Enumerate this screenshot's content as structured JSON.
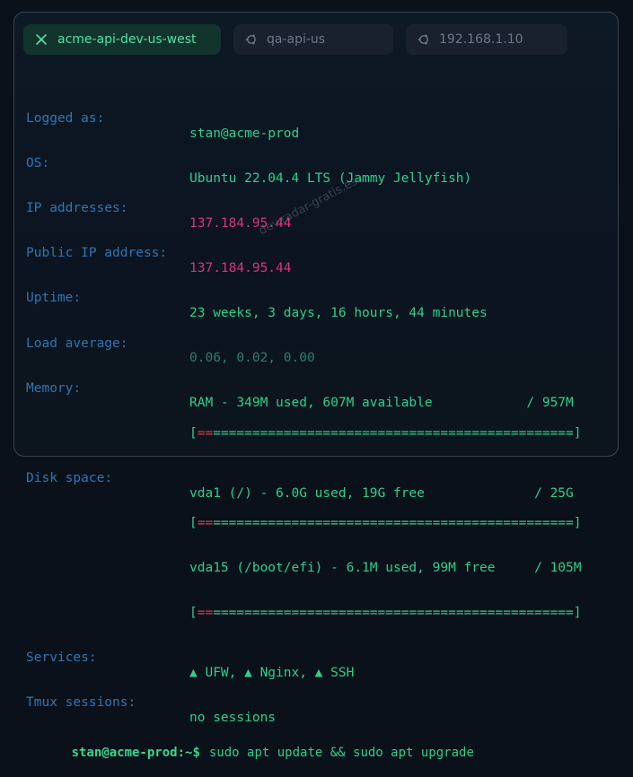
{
  "tabs": [
    {
      "label": "acme-api-dev-us-west",
      "icon": "close-icon",
      "active": true
    },
    {
      "label": "qa-api-us",
      "icon": "ubuntu-icon",
      "active": false
    },
    {
      "label": "192.168.1.10",
      "icon": "ubuntu-icon",
      "active": false
    }
  ],
  "motd": {
    "logged_label": "Logged as:",
    "logged_value": "stan@acme-prod",
    "os_label": "OS:",
    "os_value": "Ubuntu 22.04.4 LTS (Jammy Jellyfish)",
    "ip_label": "IP addresses:",
    "ip_value": "137.184.95.44",
    "public_ip_label": "Public IP address:",
    "public_ip_value": "137.184.95.44",
    "uptime_label": "Uptime:",
    "uptime_value": "23 weeks, 3 days, 16 hours, 44 minutes",
    "load_label": "Load average:",
    "load_value": "0.06, 0.02, 0.00",
    "memory_label": "Memory:",
    "memory_value": "RAM - 349M used, 607M available            / 957M",
    "memory_bar_eq": "==",
    "memory_bar_rest": "==============================================]",
    "disk_label": "Disk space:",
    "disk1_value": "vda1 (/) - 6.0G used, 19G free              / 25G",
    "disk1_bar_eq": "==",
    "disk1_bar_rest": "==============================================]",
    "disk2_value": "vda15 (/boot/efi) - 6.1M used, 99M free     / 105M",
    "disk2_bar_eq": "==",
    "disk2_bar_rest": "==============================================]",
    "bar_open": "[",
    "services_label": "Services:",
    "services_value": "▲ UFW, ▲ Nginx, ▲ SSH",
    "tmux_label": "Tmux sessions:",
    "tmux_value": "no sessions"
  },
  "prompt": {
    "text": "stan@acme-prod:~$",
    "command": "sudo apt update && sudo apt upgrade"
  },
  "watermark": "dev.radar-gratis.es",
  "colors": {
    "accent": "#4fe0a7",
    "label": "#2f76b4",
    "value": "#2ecf8c",
    "ip": "#d8357a",
    "bar_used": "#e23a4c"
  }
}
